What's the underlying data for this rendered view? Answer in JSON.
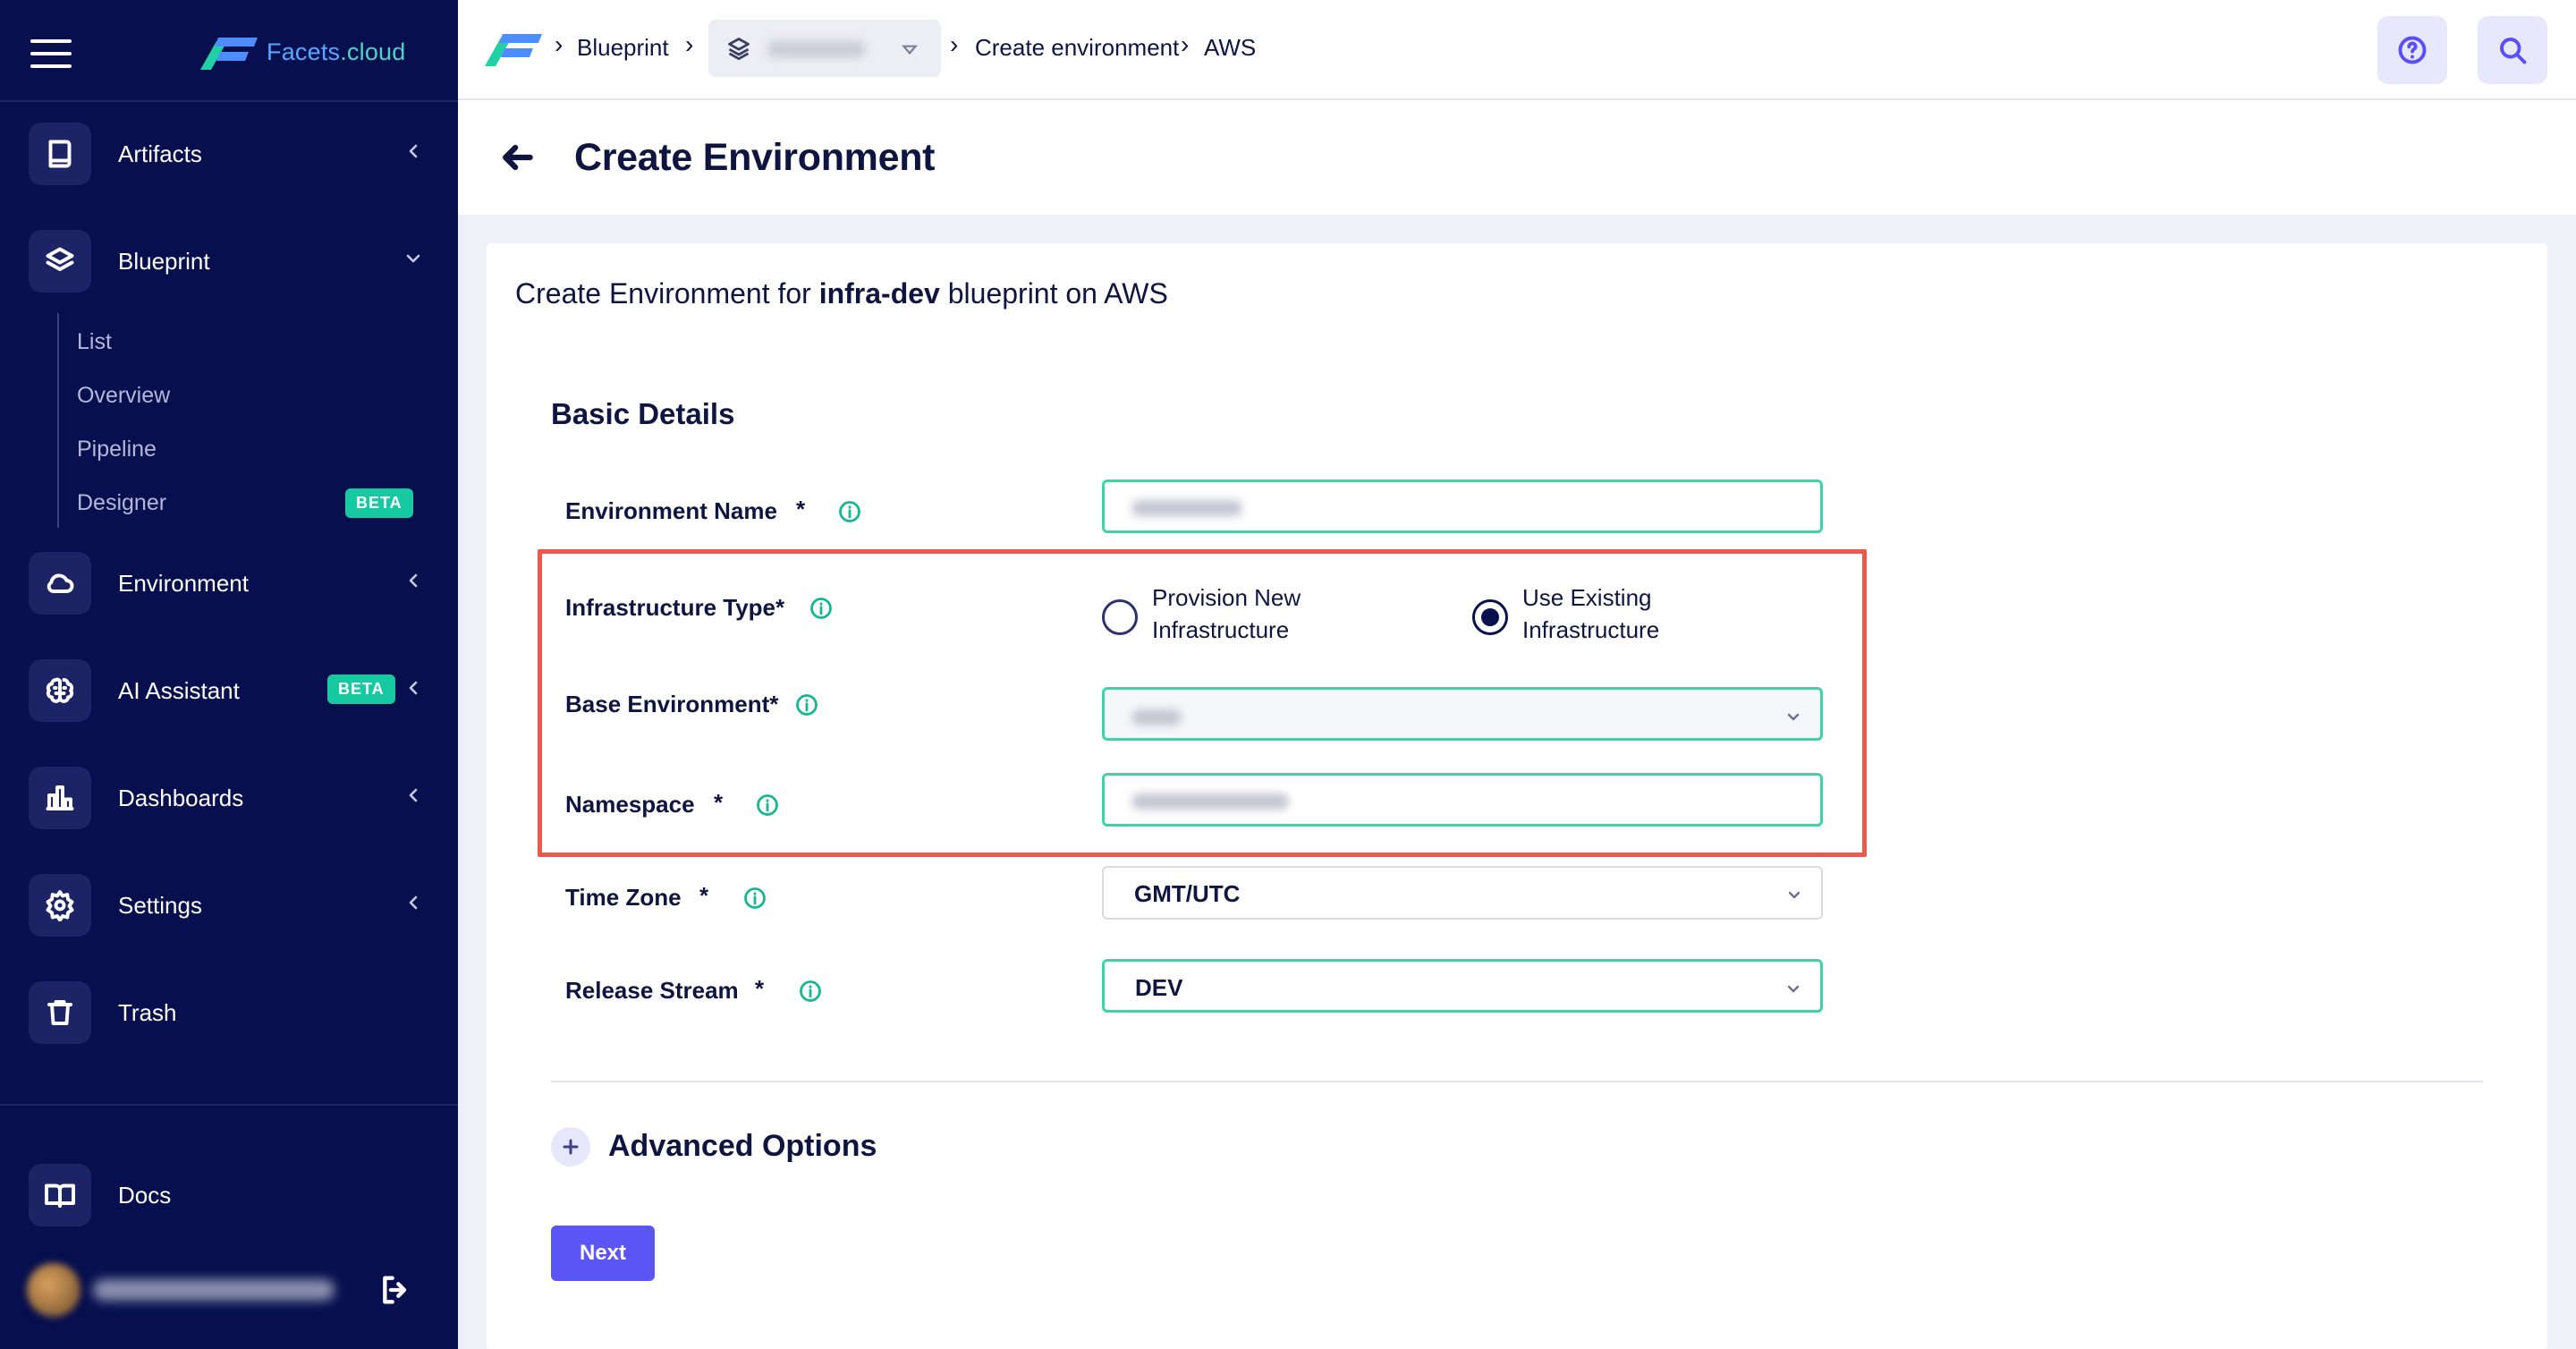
{
  "brand": {
    "name": "Facets",
    "suffix": ".cloud"
  },
  "sidebar": {
    "items": [
      {
        "label": "Artifacts",
        "icon": "book-icon"
      },
      {
        "label": "Blueprint",
        "icon": "layers-icon"
      },
      {
        "label": "Environment",
        "icon": "cloud-icon"
      },
      {
        "label": "AI Assistant",
        "icon": "brain-icon",
        "badge": "BETA"
      },
      {
        "label": "Dashboards",
        "icon": "bar-chart-icon"
      },
      {
        "label": "Settings",
        "icon": "gear-icon"
      },
      {
        "label": "Trash",
        "icon": "trash-icon"
      }
    ],
    "blueprint_sub": [
      {
        "label": "List"
      },
      {
        "label": "Overview"
      },
      {
        "label": "Pipeline"
      },
      {
        "label": "Designer",
        "badge": "BETA"
      }
    ],
    "docs": {
      "label": "Docs",
      "icon": "open-book-icon"
    }
  },
  "breadcrumb": {
    "blueprint": "Blueprint",
    "create_env": "Create environment",
    "provider": "AWS"
  },
  "page": {
    "title": "Create Environment"
  },
  "form": {
    "subtitle_prefix": "Create Environment for ",
    "blueprint_name": "infra-dev",
    "subtitle_suffix": " blueprint on AWS",
    "section_title": "Basic Details",
    "env_name": {
      "label": "Environment Name",
      "required": "*"
    },
    "infra_type": {
      "label": "Infrastructure Type*",
      "options": [
        {
          "line1": "Provision New",
          "line2": "Infrastructure",
          "selected": false
        },
        {
          "line1": "Use Existing",
          "line2": "Infrastructure",
          "selected": true
        }
      ]
    },
    "base_env": {
      "label": "Base Environment*"
    },
    "namespace": {
      "label": "Namespace",
      "required": "*"
    },
    "time_zone": {
      "label": "Time Zone",
      "required": "*",
      "value": "GMT/UTC"
    },
    "release_stream": {
      "label": "Release Stream",
      "required": "*",
      "value": "DEV"
    },
    "advanced_label": "Advanced Options",
    "next_label": "Next"
  },
  "colors": {
    "sidebar_bg": "#070f4e",
    "accent": "#5b55f6",
    "success": "#17c9a0",
    "field_border": "#3fd3a6",
    "highlight": "#f0564b"
  }
}
